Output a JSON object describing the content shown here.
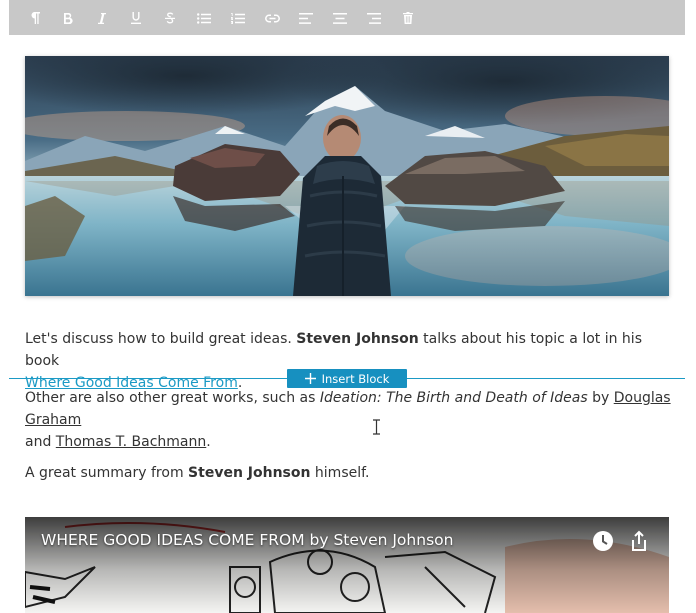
{
  "toolbar": {
    "items": [
      {
        "name": "paragraph-icon"
      },
      {
        "name": "bold-icon"
      },
      {
        "name": "italic-icon"
      },
      {
        "name": "underline-icon"
      },
      {
        "name": "strikethrough-icon"
      },
      {
        "name": "bulleted-list-icon"
      },
      {
        "name": "numbered-list-icon"
      },
      {
        "name": "link-icon"
      },
      {
        "name": "align-left-icon"
      },
      {
        "name": "align-center-icon"
      },
      {
        "name": "align-right-icon"
      },
      {
        "name": "trash-icon"
      }
    ]
  },
  "paragraph1": {
    "t1": "Let's discuss how to build great ideas. ",
    "b1": "Steven Johnson",
    "t2": " talks about his topic a lot in his book ",
    "link": "Where Good Ideas Come From",
    "t3": "."
  },
  "insert_block": {
    "label": "Insert Block"
  },
  "paragraph2": {
    "t1": "Other are also other great works, such as ",
    "i1": "Ideation: The Birth and Death of Ideas",
    "t2": " by ",
    "link1": "Douglas Graham",
    "t3": " and ",
    "link2": "Thomas T. Bachmann",
    "t4": "."
  },
  "paragraph3": {
    "t1": "A great summary from ",
    "b1": "Steven Johnson",
    "t2": " himself."
  },
  "video": {
    "title": "WHERE GOOD IDEAS COME FROM by Steven Johnson"
  },
  "colors": {
    "accent": "#1b9ac5",
    "toolbar": "#c8c8c8",
    "text": "#333333"
  }
}
